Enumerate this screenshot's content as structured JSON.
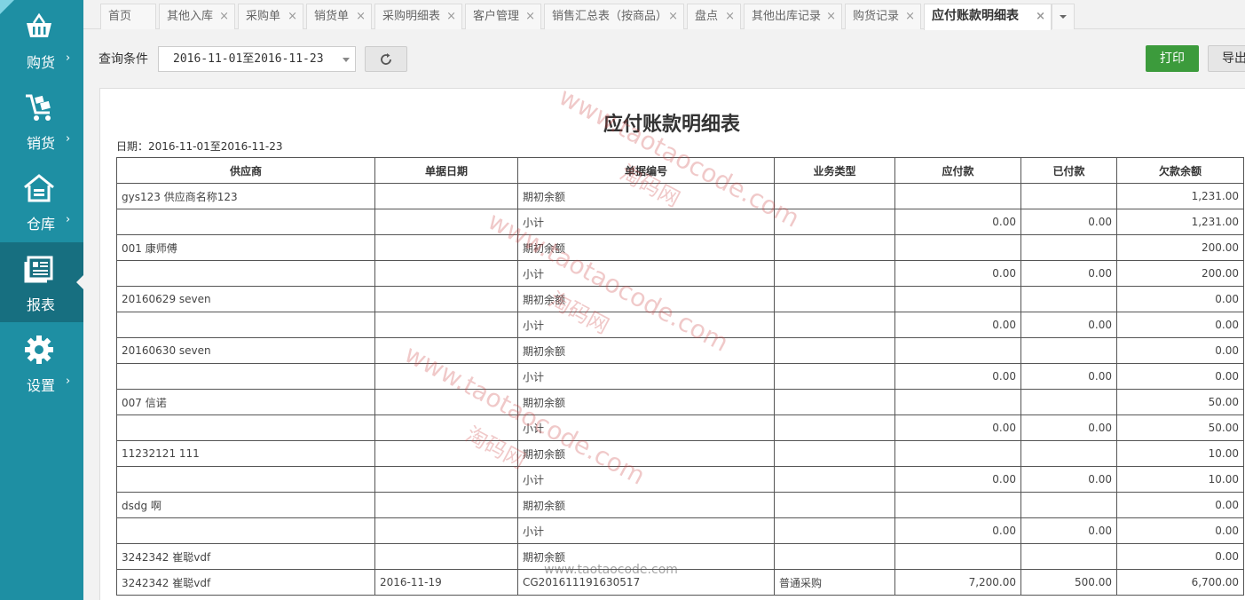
{
  "sidebar": {
    "items": [
      {
        "label": "购货",
        "icon": "basket-icon"
      },
      {
        "label": "销货",
        "icon": "cart-icon"
      },
      {
        "label": "仓库",
        "icon": "warehouse-icon"
      },
      {
        "label": "报表",
        "icon": "report-icon",
        "active": true
      },
      {
        "label": "设置",
        "icon": "gear-icon"
      }
    ],
    "arrow": "›"
  },
  "tabs": [
    {
      "label": "首页"
    },
    {
      "label": "其他入库"
    },
    {
      "label": "采购单"
    },
    {
      "label": "销货单"
    },
    {
      "label": "采购明细表"
    },
    {
      "label": "客户管理"
    },
    {
      "label": "销售汇总表（按商品）"
    },
    {
      "label": "盘点"
    },
    {
      "label": "其他出库记录"
    },
    {
      "label": "购货记录"
    },
    {
      "label": "应付账款明细表",
      "active": true
    }
  ],
  "tab_close": "×",
  "toolbar": {
    "query_label": "查询条件",
    "date_range": "2016-11-01至2016-11-23",
    "print_label": "打印",
    "export_label": "导出"
  },
  "report": {
    "title": "应付账款明细表",
    "date_line": "日期：2016-11-01至2016-11-23",
    "columns": [
      "供应商",
      "单据日期",
      "单据编号",
      "业务类型",
      "应付款",
      "已付款",
      "欠款余额"
    ],
    "rows": [
      [
        "gys123 供应商名称123",
        "",
        "期初余额",
        "",
        "",
        "",
        "1,231.00"
      ],
      [
        "",
        "",
        "小计",
        "",
        "0.00",
        "0.00",
        "1,231.00"
      ],
      [
        "001 康师傅",
        "",
        "期初余额",
        "",
        "",
        "",
        "200.00"
      ],
      [
        "",
        "",
        "小计",
        "",
        "0.00",
        "0.00",
        "200.00"
      ],
      [
        "20160629 seven",
        "",
        "期初余额",
        "",
        "",
        "",
        "0.00"
      ],
      [
        "",
        "",
        "小计",
        "",
        "0.00",
        "0.00",
        "0.00"
      ],
      [
        "20160630 seven",
        "",
        "期初余额",
        "",
        "",
        "",
        "0.00"
      ],
      [
        "",
        "",
        "小计",
        "",
        "0.00",
        "0.00",
        "0.00"
      ],
      [
        "007 信诺",
        "",
        "期初余额",
        "",
        "",
        "",
        "50.00"
      ],
      [
        "",
        "",
        "小计",
        "",
        "0.00",
        "0.00",
        "50.00"
      ],
      [
        "11232121 111",
        "",
        "期初余额",
        "",
        "",
        "",
        "10.00"
      ],
      [
        "",
        "",
        "小计",
        "",
        "0.00",
        "0.00",
        "10.00"
      ],
      [
        "dsdg 啊",
        "",
        "期初余额",
        "",
        "",
        "",
        "0.00"
      ],
      [
        "",
        "",
        "小计",
        "",
        "0.00",
        "0.00",
        "0.00"
      ],
      [
        "3242342 崔聪vdf",
        "",
        "期初余额",
        "",
        "",
        "",
        "0.00"
      ],
      [
        "3242342 崔聪vdf",
        "2016-11-19",
        "CG201611191630517",
        "普通采购",
        "7,200.00",
        "500.00",
        "6,700.00"
      ]
    ]
  },
  "watermarks": {
    "url": "www.taotaocode.com",
    "cn": "淘码网"
  },
  "colors": {
    "sidebar": "#1e8fa3",
    "sidebar_active": "#176f80",
    "print_button": "#3c9b3c"
  }
}
